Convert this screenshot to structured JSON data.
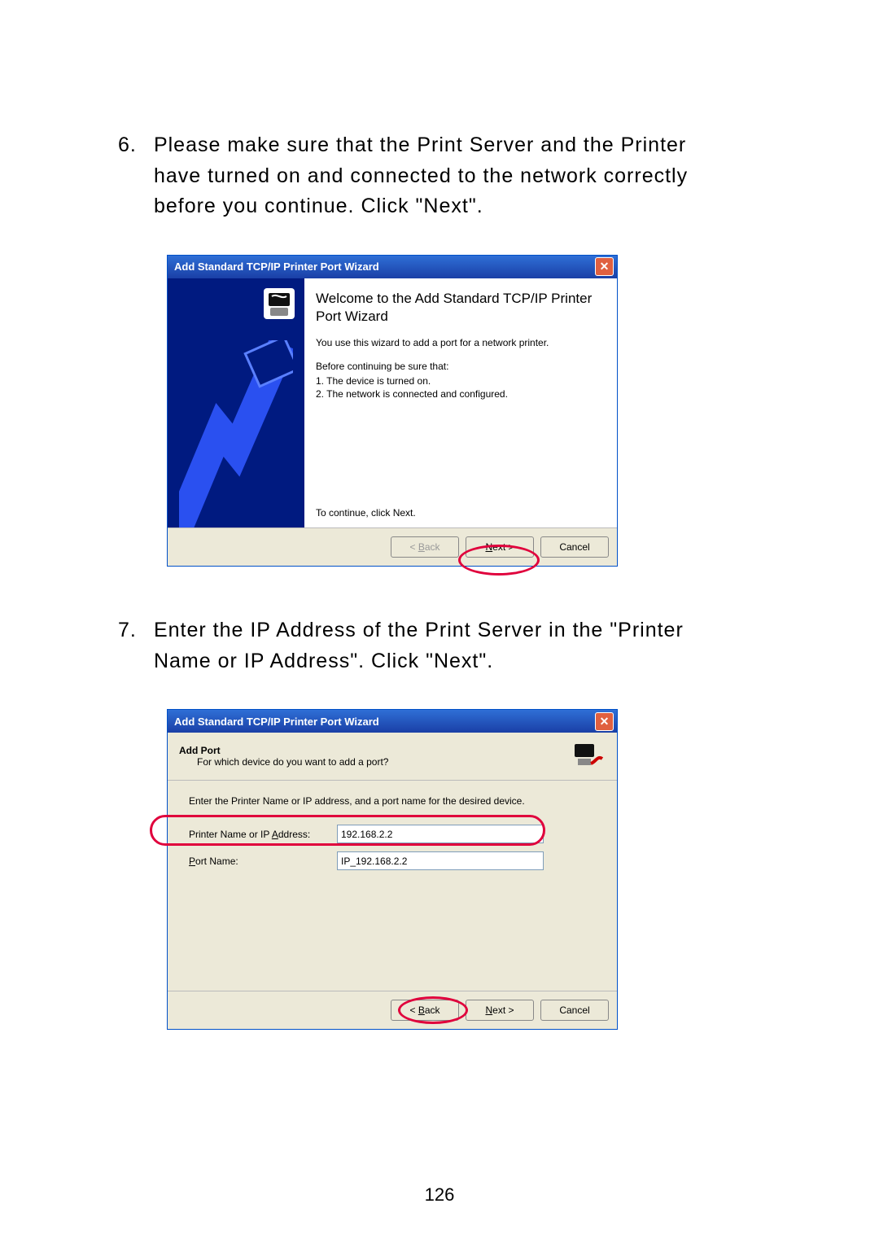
{
  "step6": {
    "num": "6.",
    "text": "Please make sure that the Print Server and the Printer have turned on and connected to the network correctly before you continue. Click \"Next\"."
  },
  "dlg1": {
    "title": "Add Standard TCP/IP Printer Port Wizard",
    "heading": "Welcome to the Add Standard TCP/IP Printer Port Wizard",
    "sub": "You use this wizard to add a port for a network printer.",
    "pre": "Before continuing be sure that:",
    "item1": "1. The device is turned on.",
    "item2": "2. The network is connected and configured.",
    "cont": "To continue, click Next.",
    "back": "< Back",
    "next": "Next >",
    "cancel": "Cancel"
  },
  "step7": {
    "num": "7.",
    "text": "Enter the IP Address of the Print Server in the \"Printer Name or IP Address\". Click \"Next\"."
  },
  "dlg2": {
    "title": "Add Standard TCP/IP Printer Port Wizard",
    "header": "Add Port",
    "header_sub": "For which device do you want to add a port?",
    "instruction": "Enter the Printer Name or IP address, and a port name for the desired device.",
    "addr_label": "Printer Name or IP Address:",
    "addr_value": "192.168.2.2",
    "port_label": "Port Name:",
    "port_value": "IP_192.168.2.2",
    "back": "< Back",
    "next": "Next >",
    "cancel": "Cancel"
  },
  "page_number": "126"
}
